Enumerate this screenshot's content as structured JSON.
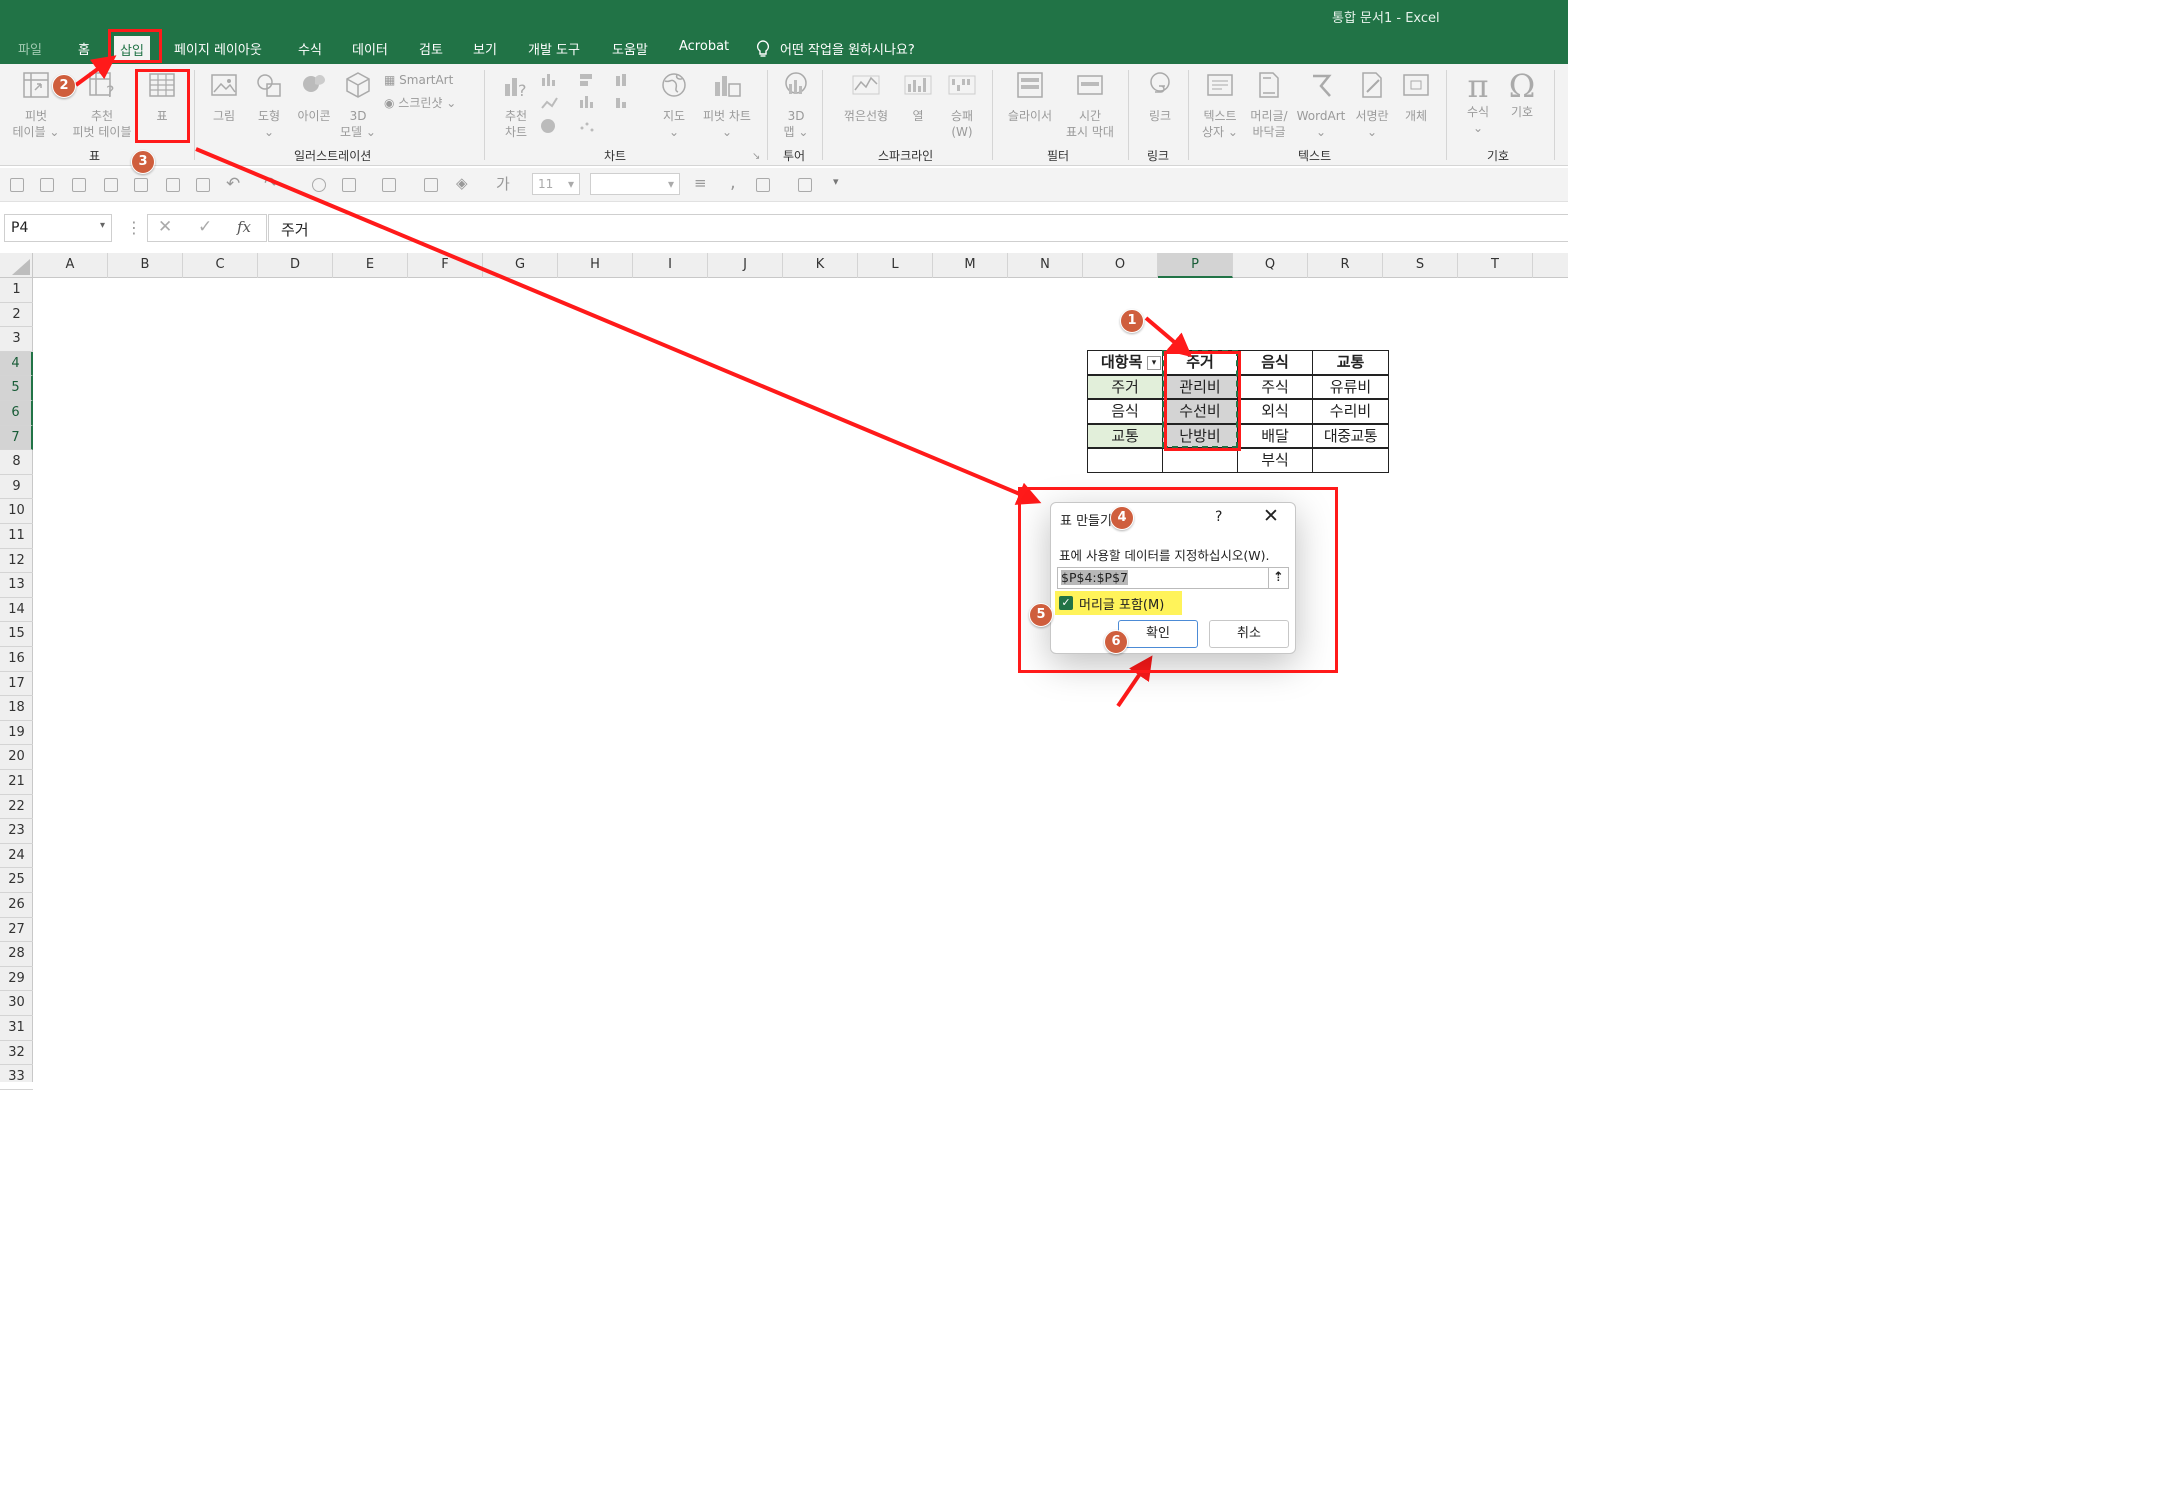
{
  "window": {
    "title": "통합 문서1  -  Excel"
  },
  "tabs": [
    "파일",
    "홈",
    "삽입",
    "페이지 레이아웃",
    "수식",
    "데이터",
    "검토",
    "보기",
    "개발 도구",
    "도움말",
    "Acrobat"
  ],
  "tell_me": "어떤 작업을 원하시나요?",
  "ribbon": {
    "tables": {
      "pivot": [
        "피벗",
        "테이블 ⌄"
      ],
      "recommended_pivot": [
        "추천",
        "피벗 테이블"
      ],
      "table": "표",
      "label": "표"
    },
    "illustrations": {
      "picture": "그림",
      "shapes": [
        "도형",
        "⌄"
      ],
      "icons": "아이콘",
      "model3d": [
        "3D",
        "모델 ⌄"
      ],
      "smartart": "SmartArt",
      "screenshot": "스크린샷 ⌄",
      "label": "일러스트레이션"
    },
    "charts": {
      "recommended": [
        "추천",
        "차트"
      ],
      "map": [
        "지도",
        "⌄"
      ],
      "pivotchart": [
        "피벗 차트",
        "⌄"
      ],
      "label": "차트"
    },
    "tours": {
      "map3d": [
        "3D",
        "맵 ⌄"
      ],
      "label": "투어"
    },
    "sparklines": {
      "line": "꺾은선형",
      "column": "열",
      "winloss": [
        "승패",
        "(W)"
      ],
      "label": "스파크라인"
    },
    "filters": {
      "slicer": "슬라이서",
      "timeline": [
        "시간",
        "표시 막대"
      ],
      "label": "필터"
    },
    "links": {
      "link": "링크",
      "label": "링크"
    },
    "text": {
      "textbox": [
        "텍스트",
        "상자 ⌄"
      ],
      "header": [
        "머리글/",
        "바닥글"
      ],
      "wordart": [
        "WordArt",
        "⌄"
      ],
      "signature": [
        "서명란",
        "⌄"
      ],
      "object": "개체",
      "label": "텍스트"
    },
    "symbols": {
      "equation": [
        "수식",
        "⌄"
      ],
      "symbol": "기호",
      "label": "기호"
    }
  },
  "qat": {
    "font_size": "11"
  },
  "formula_bar": {
    "name_box": "P4",
    "content": "주거"
  },
  "columns": [
    "A",
    "B",
    "C",
    "D",
    "E",
    "F",
    "G",
    "H",
    "I",
    "J",
    "K",
    "L",
    "M",
    "N",
    "O",
    "P",
    "Q",
    "R",
    "S",
    "T"
  ],
  "rows": [
    "1",
    "2",
    "3",
    "4",
    "5",
    "6",
    "7",
    "8",
    "9",
    "10",
    "11",
    "12",
    "13",
    "14",
    "15",
    "16",
    "17",
    "18",
    "19",
    "20",
    "21",
    "22",
    "23",
    "24",
    "25",
    "26",
    "27",
    "28",
    "29",
    "30",
    "31",
    "32",
    "33"
  ],
  "sheet": {
    "headers": [
      "대항목",
      "주거",
      "음식",
      "교통"
    ],
    "col_o": [
      "주거",
      "음식",
      "교통"
    ],
    "col_p": [
      "관리비",
      "수선비",
      "난방비"
    ],
    "col_q": [
      "주식",
      "외식",
      "배달",
      "부식"
    ],
    "col_r": [
      "유류비",
      "수리비",
      "대중교통"
    ]
  },
  "dialog": {
    "title": "표 만들기",
    "help": "?",
    "close": "✕",
    "prompt": "표에 사용할 데이터를 지정하십시오(W).",
    "range": "$P$4:$P$7",
    "has_headers": "머리글 포함(M)",
    "ok": "확인",
    "cancel": "취소"
  },
  "annotations": {
    "steps": [
      "1",
      "2",
      "3",
      "4",
      "5",
      "6"
    ],
    "color": "#ff1a1a",
    "badge_color": "#cf5e3d"
  }
}
